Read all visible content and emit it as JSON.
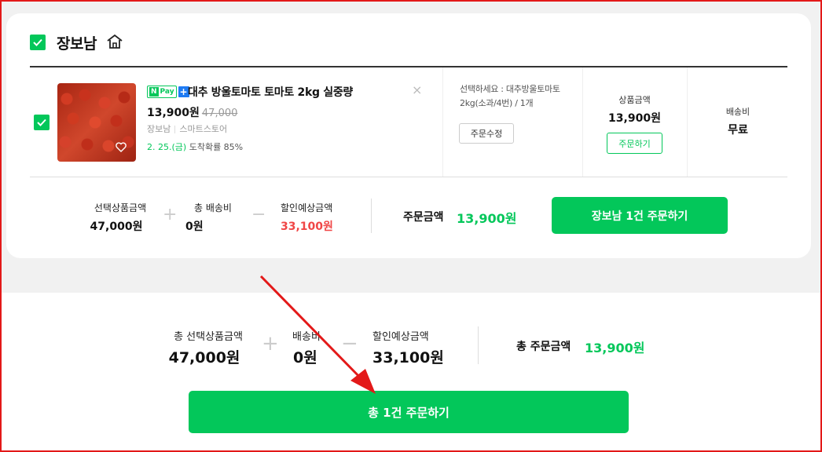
{
  "store": {
    "name": "장보남",
    "checked": true
  },
  "product": {
    "checked": true,
    "npay_badge": "Pay",
    "npay_n": "N",
    "npay_plus": "+",
    "name": "대추 방울토마토 토마토 2kg 실중량",
    "price": "13,900원",
    "original_price": "47,000",
    "seller": "장보남",
    "seller_type": "스마트스토어",
    "delivery_date": "2. 25.(금)",
    "delivery_prob": "도착확률 85%",
    "close": "×"
  },
  "option": {
    "text": "선택하세요 : 대추방울토마토 2kg(소과/4번) / 1개",
    "edit_button": "주문수정"
  },
  "item_price": {
    "label": "상품금액",
    "value": "13,900원",
    "order_button": "주문하기"
  },
  "shipping": {
    "label": "배송비",
    "value": "무료"
  },
  "store_summary": {
    "selected_label": "선택상품금액",
    "selected_value": "47,000원",
    "plus": "+",
    "shipping_label": "총 배송비",
    "shipping_value": "0원",
    "minus": "−",
    "discount_label": "할인예상금액",
    "discount_value": "33,100원",
    "order_label": "주문금액",
    "order_value": "13,900원",
    "order_button": "장보남 1건 주문하기"
  },
  "total_summary": {
    "selected_label": "총 선택상품금액",
    "selected_value": "47,000원",
    "plus": "+",
    "shipping_label": "배송비",
    "shipping_value": "0원",
    "minus": "−",
    "discount_label": "할인예상금액",
    "discount_value": "33,100원",
    "order_label": "총 주문금액",
    "order_value": "13,900원",
    "order_button": "총 1건 주문하기"
  },
  "colors": {
    "accent_green": "#03c75a",
    "discount_red": "#f04646",
    "annotation_red": "#e31919"
  }
}
